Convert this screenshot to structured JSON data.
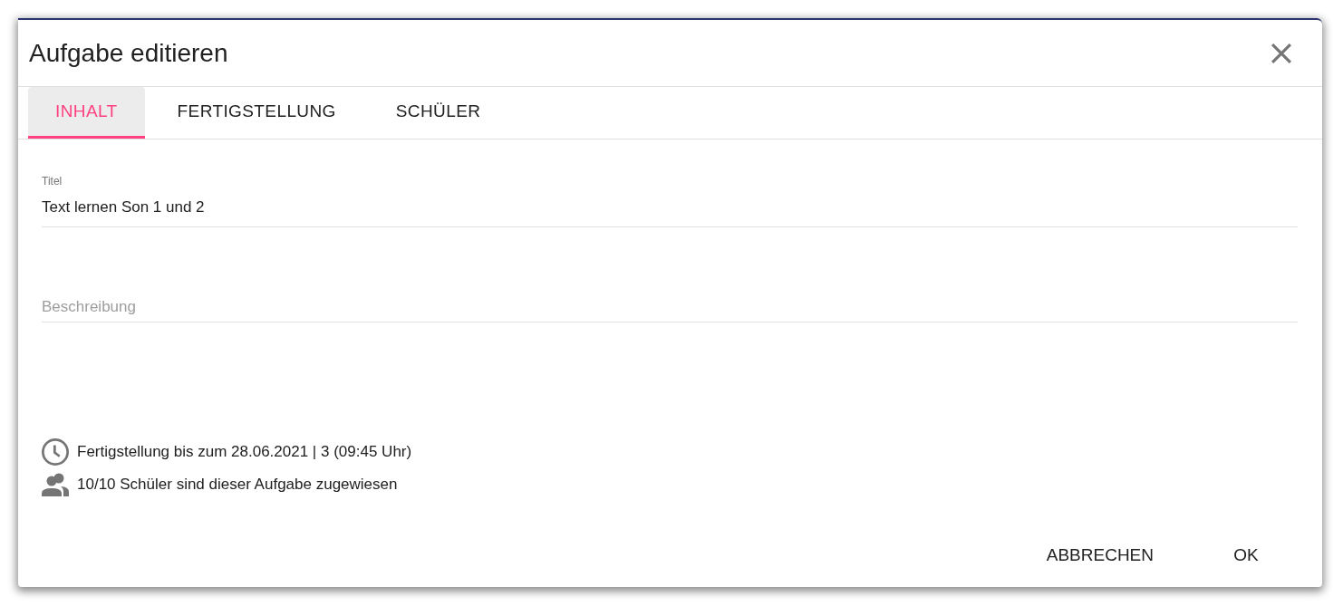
{
  "dialog": {
    "title": "Aufgabe editieren"
  },
  "tabs": [
    {
      "label": "INHALT",
      "selected": true
    },
    {
      "label": "FERTIGSTELLUNG",
      "selected": false
    },
    {
      "label": "SCHÜLER",
      "selected": false
    }
  ],
  "fields": [
    {
      "label": "Titel",
      "value": "Text lernen Son 1 und 2"
    },
    {
      "placeholder": "Beschreibung"
    }
  ],
  "info": [
    {
      "kind": "deadline",
      "text": "Fertigstellung bis zum 28.06.2021 | 3 (09:45 Uhr)"
    },
    {
      "kind": "students",
      "text": "10/10 Schüler sind dieser Aufgabe zugewiesen"
    }
  ],
  "buttons": [
    "ABBRECHEN",
    "OK"
  ]
}
